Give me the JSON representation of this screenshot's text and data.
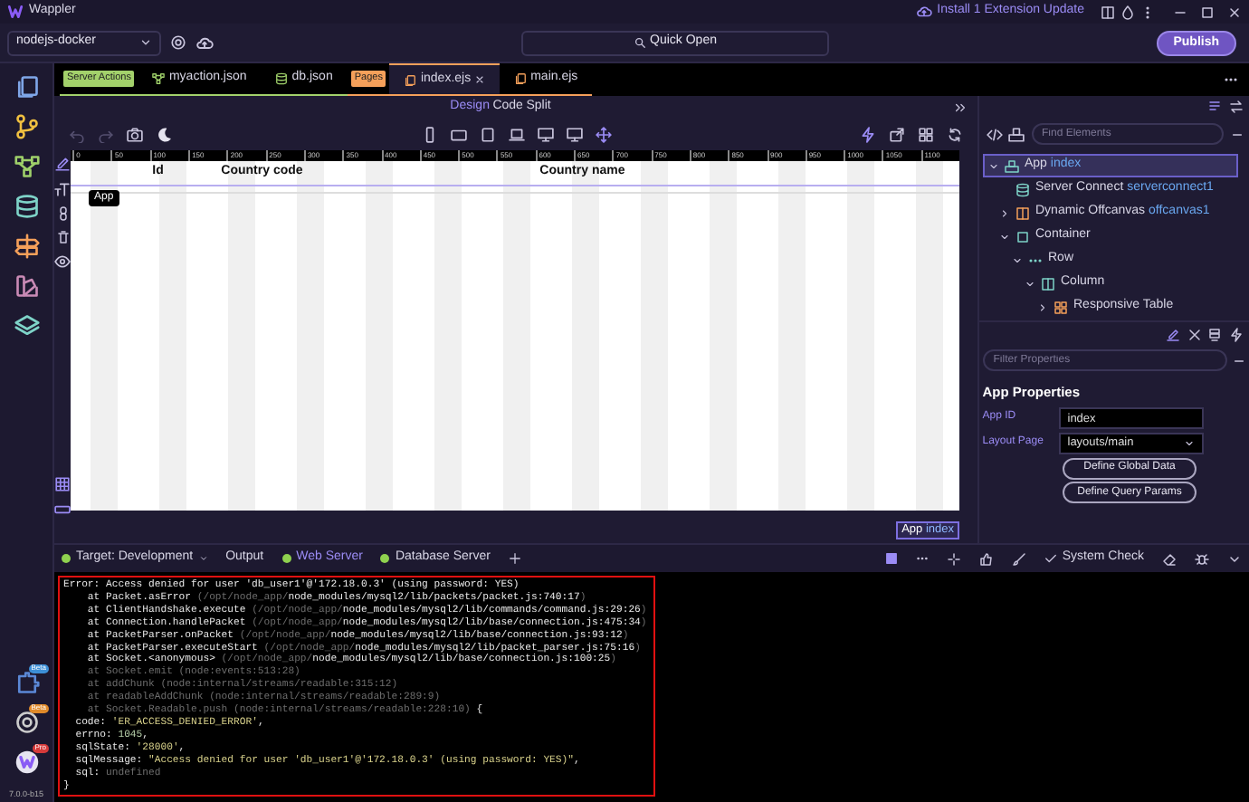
{
  "title_bar": {
    "app_name": "Wappler",
    "update_notice": "Install 1 Extension Update"
  },
  "toolbar": {
    "project": "nodejs-docker",
    "quick_open": "Quick Open",
    "publish": "Publish"
  },
  "sidebar": {
    "badges": [
      {
        "label": "Beta"
      },
      {
        "label": "Beta"
      },
      {
        "label": "Pro"
      }
    ],
    "version": "7.0.0-b15"
  },
  "tab_groups": [
    {
      "label": "Server Actions",
      "color": "#a3d16b",
      "tabs": [
        {
          "label": "myaction.json",
          "kind": "flow",
          "selected": false
        },
        {
          "label": "db.json",
          "kind": "database",
          "selected": false
        }
      ]
    },
    {
      "label": "Pages",
      "color": "#f5a05a",
      "tabs": [
        {
          "label": "index.ejs",
          "kind": "page",
          "selected": true
        },
        {
          "label": "main.ejs",
          "kind": "page",
          "selected": false
        }
      ]
    }
  ],
  "view_modes": [
    {
      "label": "Design",
      "selected": true
    },
    {
      "label": "Code",
      "selected": false
    },
    {
      "label": "Split",
      "selected": false
    }
  ],
  "canvas": {
    "ruler": [
      "0",
      "50",
      "100",
      "150",
      "200",
      "250",
      "300",
      "350",
      "400",
      "450",
      "500",
      "550",
      "600",
      "650",
      "700",
      "750",
      "800",
      "850",
      "900",
      "950",
      "1000",
      "1050",
      "1100"
    ],
    "tooltip": "App",
    "columns": [
      "Id",
      "Country code",
      "Country name"
    ],
    "selection_label": {
      "component": "App",
      "id": "index"
    }
  },
  "element_search": {
    "placeholder": "Find Elements"
  },
  "tree": [
    {
      "label": "App",
      "id": "index",
      "kind": "app",
      "selected": true,
      "expanded": true,
      "children": [
        {
          "label": "Server Connect",
          "id": "serverconnect1",
          "kind": "server-connect",
          "selected": false
        },
        {
          "label": "Dynamic Offcanvas",
          "id": "offcanvas1",
          "kind": "offcanvas",
          "selected": false,
          "expanded": false
        },
        {
          "label": "Container",
          "kind": "container",
          "selected": false,
          "expanded": true,
          "children": [
            {
              "label": "Row",
              "kind": "row",
              "selected": false,
              "expanded": true,
              "children": [
                {
                  "label": "Column",
                  "kind": "column",
                  "selected": false,
                  "expanded": true,
                  "children": [
                    {
                      "label": "Responsive Table",
                      "kind": "table",
                      "selected": false,
                      "expanded": false
                    }
                  ]
                }
              ]
            }
          ]
        }
      ]
    }
  ],
  "properties": {
    "filter_placeholder": "Filter Properties",
    "title": "App Properties",
    "fields": [
      {
        "kind": "text",
        "label": "App ID",
        "value": "index"
      },
      {
        "kind": "select",
        "label": "Layout Page",
        "value": "layouts/main"
      }
    ],
    "buttons": [
      "Define Global Data",
      "Define Query Params"
    ]
  },
  "bottom_tabs": [
    {
      "label": "Target: Development",
      "kind": "dropdown",
      "color": "#8fd14f",
      "selected": false
    },
    {
      "label": "Output",
      "kind": "plain",
      "selected": false
    },
    {
      "label": "Web Server",
      "kind": "plain",
      "color": "#8fd14f",
      "selected": true
    },
    {
      "label": "Database Server",
      "kind": "plain",
      "color": "#8fd14f",
      "selected": false
    }
  ],
  "system_check": "System Check",
  "console": {
    "lines": [
      [
        {
          "text": "Error: Access denied for user 'db_user1'@'172.18.0.3' (using password: YES)",
          "kind": "normal"
        }
      ],
      [
        {
          "text": "    at Packet.asError ",
          "kind": "normal"
        },
        {
          "text": "(/opt/node_app/",
          "kind": "dim"
        },
        {
          "text": "node_modules/mysql2/lib/packets/packet.js:740:17",
          "kind": "normal"
        },
        {
          "text": ")",
          "kind": "dim"
        }
      ],
      [
        {
          "text": "    at ClientHandshake.execute ",
          "kind": "normal"
        },
        {
          "text": "(/opt/node_app/",
          "kind": "dim"
        },
        {
          "text": "node_modules/mysql2/lib/commands/command.js:29:26",
          "kind": "normal"
        },
        {
          "text": ")",
          "kind": "dim"
        }
      ],
      [
        {
          "text": "    at Connection.handlePacket ",
          "kind": "normal"
        },
        {
          "text": "(/opt/node_app/",
          "kind": "dim"
        },
        {
          "text": "node_modules/mysql2/lib/base/connection.js:475:34",
          "kind": "normal"
        },
        {
          "text": ")",
          "kind": "dim"
        }
      ],
      [
        {
          "text": "    at PacketParser.onPacket ",
          "kind": "normal"
        },
        {
          "text": "(/opt/node_app/",
          "kind": "dim"
        },
        {
          "text": "node_modules/mysql2/lib/base/connection.js:93:12",
          "kind": "normal"
        },
        {
          "text": ")",
          "kind": "dim"
        }
      ],
      [
        {
          "text": "    at PacketParser.executeStart ",
          "kind": "normal"
        },
        {
          "text": "(/opt/node_app/",
          "kind": "dim"
        },
        {
          "text": "node_modules/mysql2/lib/packet_parser.js:75:16",
          "kind": "normal"
        },
        {
          "text": ")",
          "kind": "dim"
        }
      ],
      [
        {
          "text": "    at Socket.<anonymous> ",
          "kind": "normal"
        },
        {
          "text": "(/opt/node_app/",
          "kind": "dim"
        },
        {
          "text": "node_modules/mysql2/lib/base/connection.js:100:25",
          "kind": "normal"
        },
        {
          "text": ")",
          "kind": "dim"
        }
      ],
      [
        {
          "text": "    at Socket.emit (node:events:513:28)",
          "kind": "dim"
        }
      ],
      [
        {
          "text": "    at addChunk (node:internal/streams/readable:315:12)",
          "kind": "dim"
        }
      ],
      [
        {
          "text": "    at readableAddChunk (node:internal/streams/readable:289:9)",
          "kind": "dim"
        }
      ],
      [
        {
          "text": "    at Socket.Readable.push (node:internal/streams/readable:228:10)",
          "kind": "dim"
        },
        {
          "text": " {",
          "kind": "normal"
        }
      ],
      [
        {
          "text": "  code: ",
          "kind": "normal"
        },
        {
          "text": "'ER_ACCESS_DENIED_ERROR'",
          "kind": "string"
        },
        {
          "text": ",",
          "kind": "normal"
        }
      ],
      [
        {
          "text": "  errno: ",
          "kind": "normal"
        },
        {
          "text": "1045",
          "kind": "number"
        },
        {
          "text": ",",
          "kind": "normal"
        }
      ],
      [
        {
          "text": "  sqlState: ",
          "kind": "normal"
        },
        {
          "text": "'28000'",
          "kind": "string"
        },
        {
          "text": ",",
          "kind": "normal"
        }
      ],
      [
        {
          "text": "  sqlMessage: ",
          "kind": "normal"
        },
        {
          "text": "\"Access denied for user 'db_user1'@'172.18.0.3' (using password: YES)\"",
          "kind": "string"
        },
        {
          "text": ",",
          "kind": "normal"
        }
      ],
      [
        {
          "text": "  sql: ",
          "kind": "normal"
        },
        {
          "text": "undefined",
          "kind": "dim"
        }
      ],
      [
        {
          "text": "}",
          "kind": "normal"
        }
      ]
    ]
  }
}
